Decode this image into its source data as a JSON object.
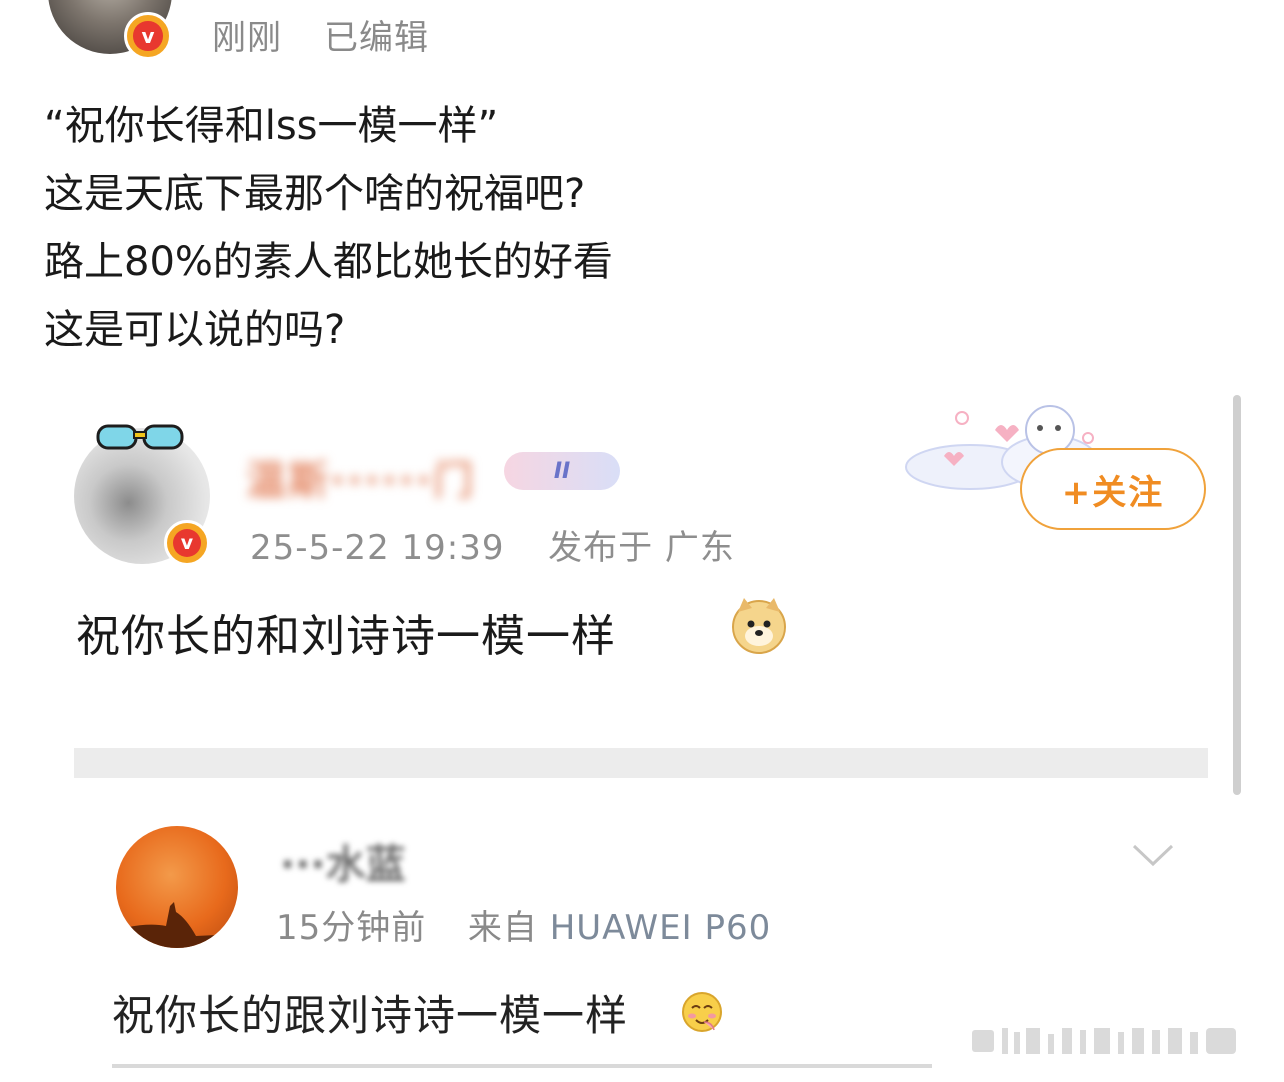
{
  "header": {
    "time": "刚刚",
    "edited": "已编辑"
  },
  "post": {
    "lines": [
      "“祝你长得和lss一模一样”",
      "这是天底下最那个啥的祝福吧?",
      "路上80%的素人都比她长的好看",
      "这是可以说的吗?"
    ]
  },
  "embedded1": {
    "username": "温斯······门",
    "badge": "II",
    "datetime": "25-5-22 19:39",
    "location": "发布于 广东",
    "follow_label": "+关注",
    "comment": "祝你长的和刘诗诗一模一样",
    "emoji_icon": "doge-emoji"
  },
  "embedded2": {
    "username": "···水蓝",
    "time": "15分钟前",
    "source_prefix": "来自",
    "device": "HUAWEI P60",
    "comment": "祝你长的跟刘诗诗一模一样",
    "emoji_icon": "blush-emoji"
  },
  "colors": {
    "follow": "#f08c22",
    "vip_badge": "#e8382f",
    "meta": "#8a8a8a"
  }
}
